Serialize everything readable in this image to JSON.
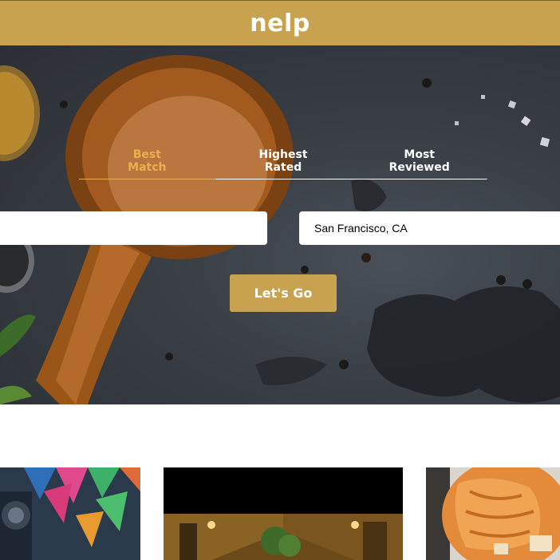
{
  "header": {
    "logo": "nelp"
  },
  "search": {
    "tabs": [
      {
        "label": "Best\nMatch",
        "active": true
      },
      {
        "label": "Highest\nRated",
        "active": false
      },
      {
        "label": "Most\nReviewed",
        "active": false
      }
    ],
    "term_value": "",
    "location_value": "San Francisco, CA",
    "submit_label": "Let's Go"
  },
  "colors": {
    "accent": "#c9a24f",
    "active_tab": "#e8b04f"
  },
  "icons": {
    "hero": "wooden-spoon-on-slate-image"
  }
}
